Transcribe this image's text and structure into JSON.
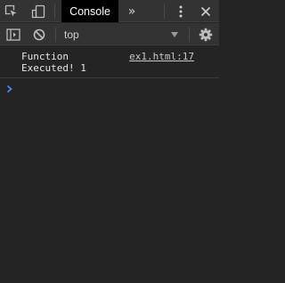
{
  "tabbar": {
    "console_tab": "Console",
    "more_tabs": "»",
    "icons": [
      "inspect-element-icon",
      "device-toolbar-icon",
      "kebab-menu-icon",
      "close-icon"
    ]
  },
  "toolbar": {
    "context": "top",
    "icons": [
      "sidebar-toggle-icon",
      "clear-console-icon",
      "dropdown-caret-icon",
      "settings-gear-icon"
    ]
  },
  "messages": [
    {
      "text": "Function\nExecuted! 1",
      "source": "ex1.html:17"
    }
  ],
  "prompt": {
    "icon": "prompt-chevron-icon"
  },
  "colors": {
    "panel_bg": "#242424",
    "toolbar_bg": "#333333",
    "active_tab_bg": "#000000",
    "prompt_accent": "#4a8cff"
  }
}
